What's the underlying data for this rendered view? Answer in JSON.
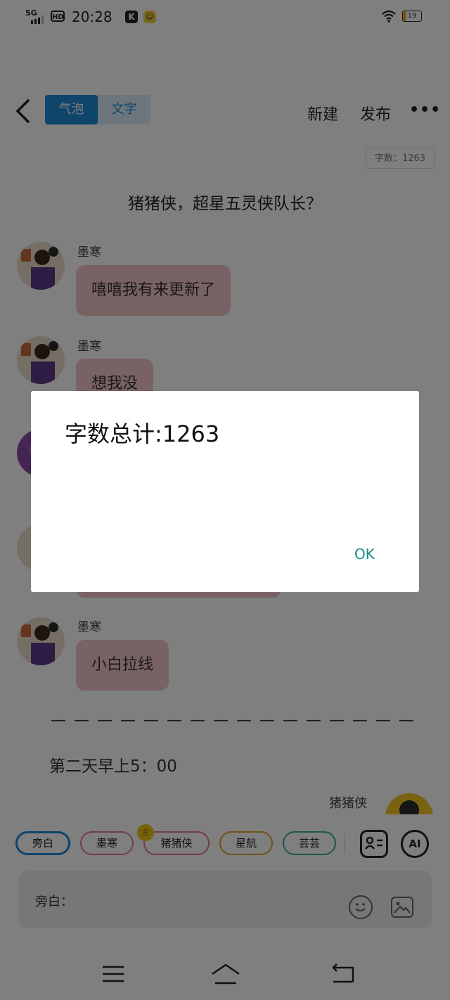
{
  "status_bar": {
    "network": "5G",
    "hd": "HD",
    "time": "20:28",
    "k_icon": "K",
    "battery": "19",
    "battery_level_pct": 19
  },
  "header": {
    "tabs": [
      "气泡",
      "文字"
    ],
    "active_tab": 0,
    "new_label": "新建",
    "publish_label": "发布",
    "more_label": "•••"
  },
  "word_count_badge": "字数：1263",
  "story_title": "猪猪侠，超星五灵侠队长？",
  "messages": [
    {
      "name": "墨寒",
      "text": "嘻嘻我有来更新了"
    },
    {
      "name": "墨寒",
      "text": "想我没"
    },
    {
      "name": "墨寒",
      "text": "小白拉线"
    }
  ],
  "divider": "— — — — — — — — — — — — — — — —",
  "time_line": "第二天早上5：00",
  "right_sender": "猪猪侠",
  "roles": [
    {
      "label": "旁白",
      "color": "#1e88d6",
      "active": true
    },
    {
      "label": "墨寒",
      "color": "#e07b8a",
      "active": false
    },
    {
      "label": "猪猪侠",
      "color": "#e07b8a",
      "active": false
    },
    {
      "label": "星航",
      "color": "#e0a22a",
      "active": false
    },
    {
      "label": "芸芸",
      "color": "#3bb08f",
      "active": false
    }
  ],
  "crown_label": "主",
  "ai_label": "AI",
  "input_label": "旁白：",
  "dialog": {
    "message": "字数总计:1263",
    "ok_label": "OK"
  }
}
